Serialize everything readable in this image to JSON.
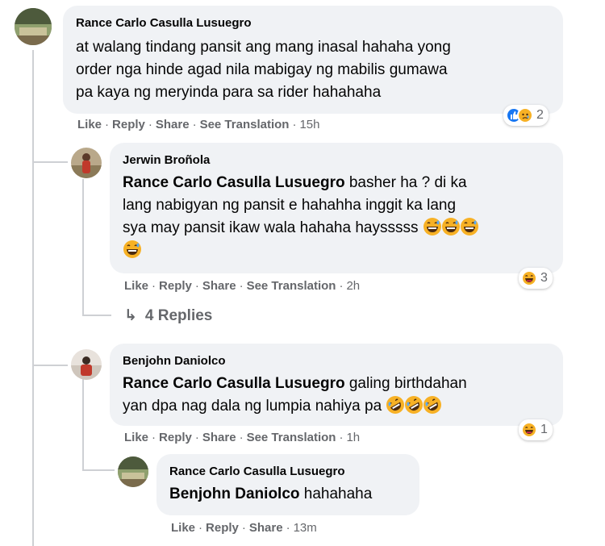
{
  "comment": {
    "author": "Rance Carlo Casulla Lusuegro",
    "lines": [
      "at walang tindang pansit ang mang inasal hahaha yong",
      "order nga hinde agad nila mabigay ng mabilis gumawa",
      "pa kaya ng meryinda para sa rider hahahaha"
    ],
    "actions": {
      "like": "Like",
      "reply": "Reply",
      "share": "Share",
      "translate": "See Translation"
    },
    "time": "15h",
    "reactions": {
      "icons": [
        "like-icon",
        "sad-icon"
      ],
      "count": "2"
    }
  },
  "reply1": {
    "author": "Jerwin Broñola",
    "mention": "Rance Carlo Casulla Lusuegro",
    "line1_rest": " basher ha ? di ka",
    "line2": "lang nabigyan ng pansit e hahahha inggit ka lang",
    "line3": "sya may pansit ikaw wala hahaha haysssss",
    "emojis": [
      "grinning-sweat-emoji",
      "grinning-sweat-emoji",
      "grinning-sweat-emoji",
      "grinning-sweat-emoji"
    ],
    "actions": {
      "like": "Like",
      "reply": "Reply",
      "share": "Share",
      "translate": "See Translation"
    },
    "time": "2h",
    "reactions": {
      "icons": [
        "haha-icon"
      ],
      "count": "3"
    }
  },
  "more_replies": {
    "arrow": "↳",
    "label": "4 Replies"
  },
  "reply2": {
    "author": "Benjohn Daniolco",
    "mention": "Rance Carlo Casulla Lusuegro",
    "line1_rest": " galing birthdahan",
    "line2": "yan dpa nag dala ng lumpia nahiya pa",
    "emojis": [
      "rofl-emoji",
      "rofl-emoji",
      "rofl-emoji"
    ],
    "actions": {
      "like": "Like",
      "reply": "Reply",
      "share": "Share",
      "translate": "See Translation"
    },
    "time": "1h",
    "reactions": {
      "icons": [
        "haha-icon"
      ],
      "count": "1"
    }
  },
  "reply3": {
    "author": "Rance Carlo Casulla Lusuegro",
    "mention": "Benjohn Daniolco",
    "text_rest": " hahahaha",
    "actions": {
      "like": "Like",
      "reply": "Reply",
      "share": "Share"
    },
    "time": "13m"
  },
  "colors": {
    "bubble": "#f0f2f5",
    "meta": "#65676b",
    "like_blue": "#1877f2",
    "emoji_yellow": "#f7b125"
  }
}
